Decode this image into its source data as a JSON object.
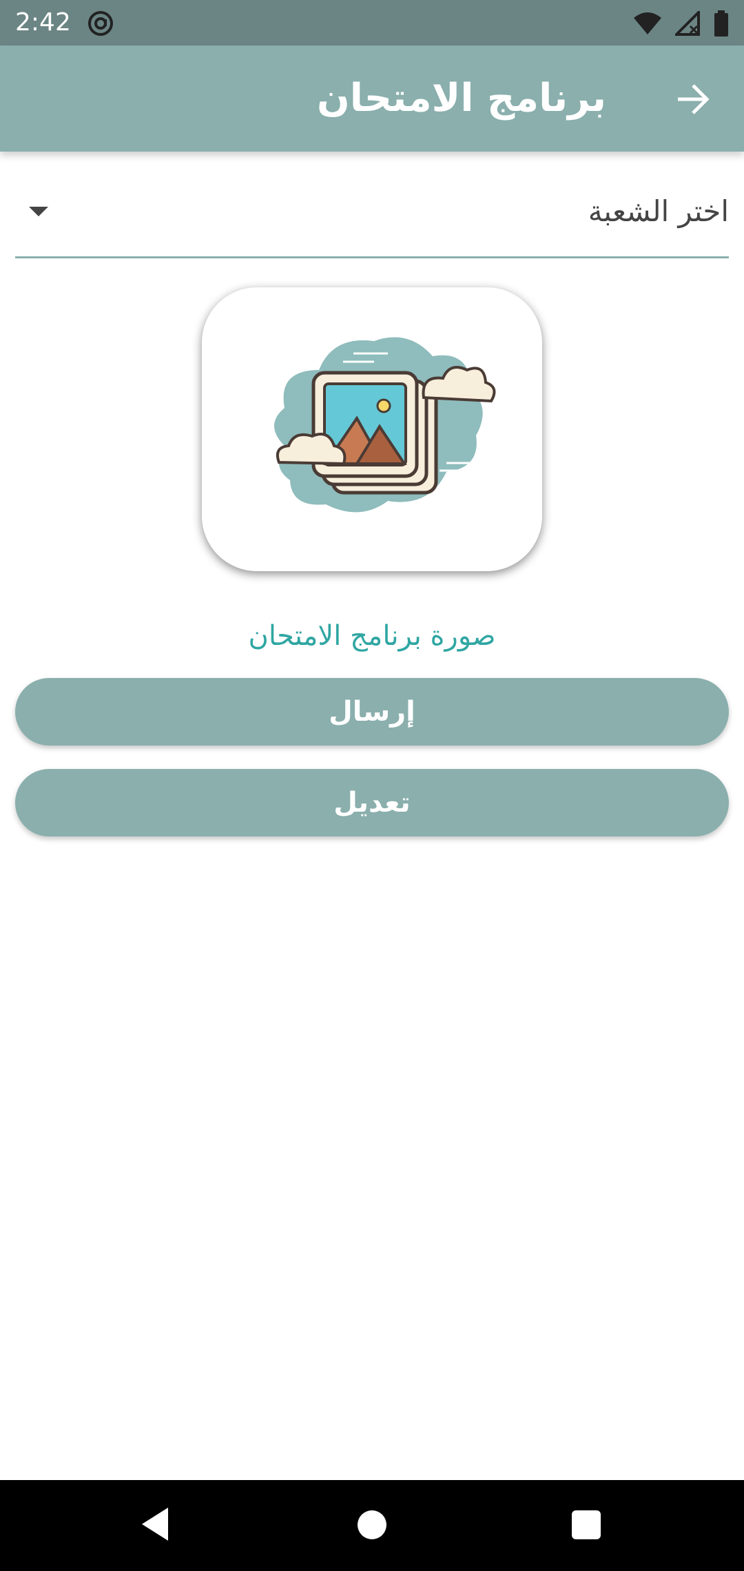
{
  "status_bar": {
    "time": "2:42",
    "icons": [
      "at-sign-icon",
      "wifi-icon",
      "signal-no-data-icon",
      "battery-icon"
    ]
  },
  "app_bar": {
    "title": "برنامج الامتحان",
    "back_icon": "arrow-right-icon",
    "color": "#8aafad"
  },
  "form": {
    "section_select": {
      "value": "اختر الشعبة",
      "icon": "caret-down-icon"
    },
    "image_placeholder_icon": "image-gallery-icon",
    "image_caption": "صورة برنامج الامتحان",
    "send_button_label": "إرسال",
    "edit_button_label": "تعديل"
  },
  "colors": {
    "accent": "#8aafad",
    "caption": "#2fa6a2",
    "status_bar": "#6b8584"
  },
  "nav_bar": {
    "icons": [
      "back-triangle-icon",
      "home-circle-icon",
      "recents-square-icon"
    ]
  }
}
